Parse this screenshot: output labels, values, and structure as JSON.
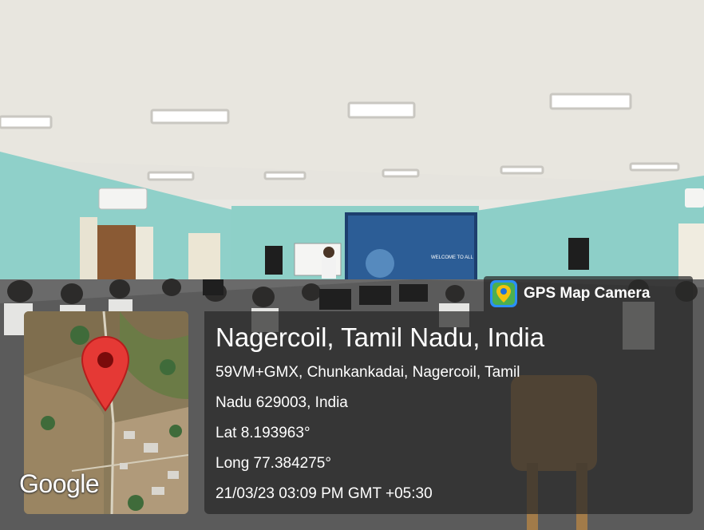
{
  "badge": {
    "app_name": "GPS Map Camera",
    "icon": "map-pin-app-icon"
  },
  "map": {
    "logo_text": "Google",
    "marker_icon": "location-pin-icon",
    "marker_color": "#e53935"
  },
  "location": {
    "title": "Nagercoil, Tamil Nadu, India",
    "address_line_1": "59VM+GMX, Chunkankadai, Nagercoil, Tamil",
    "address_line_2": "Nadu 629003, India",
    "latitude": "Lat 8.193963°",
    "longitude": "Long 77.384275°",
    "datetime": "21/03/23 03:09 PM GMT +05:30"
  },
  "projector_screen": {
    "line1": "WELCOME TO ALL"
  }
}
